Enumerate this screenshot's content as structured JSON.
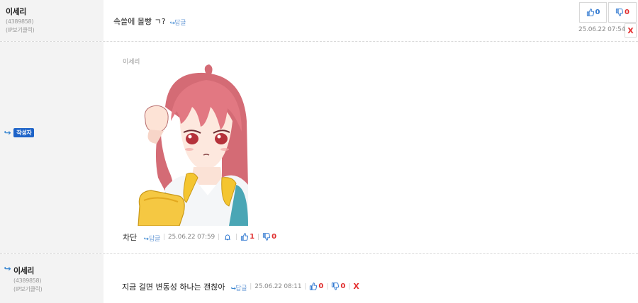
{
  "comment1": {
    "nick": "이세리",
    "uid": "(4389858)",
    "ip": "(IP보기클릭)",
    "text": "속쓸에 몰빵 ㄱ?",
    "reply": "답글",
    "likes": "0",
    "dislikes": "0",
    "time": "25.06.22 07:54",
    "delete": "X"
  },
  "comment2": {
    "badge": "작성자",
    "image_caption": "이세리",
    "image_alt": "anime girl with pink hair holding a yellow object",
    "text": "차단",
    "reply": "답글",
    "time": "25.06.22 07:59",
    "likes": "1",
    "dislikes": "0"
  },
  "comment3": {
    "nick": "이세리",
    "uid": "(4389858)",
    "ip": "(IP보기클릭)",
    "text": "지금 걸면 변동성 하나는 괜찮아",
    "reply": "답글",
    "time": "25.06.22 08:11",
    "likes": "0",
    "dislikes": "0",
    "delete": "X"
  },
  "colors": {
    "accent_blue": "#2e77d0",
    "accent_red": "#e03030",
    "badge_blue": "#1d63c8",
    "left_column_bg": "#f3f3f3"
  }
}
